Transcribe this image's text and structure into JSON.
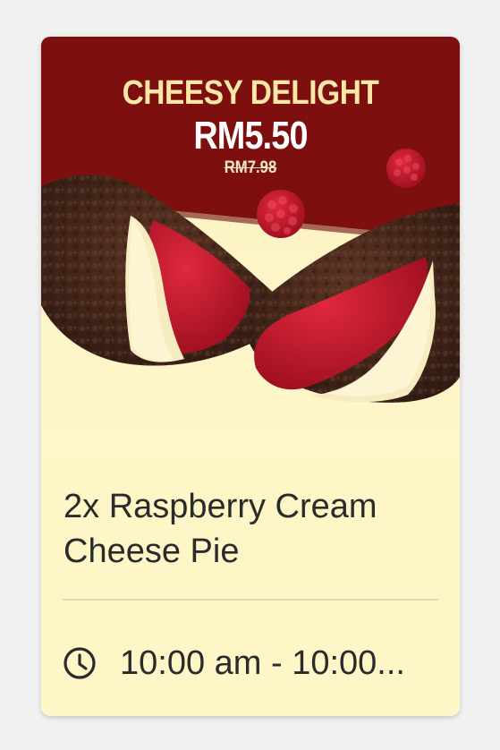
{
  "promo": {
    "headline": "CHEESY DELIGHT",
    "price": "RM5.50",
    "original_price": "RM7.98"
  },
  "product": {
    "title": "2x Raspberry Cream Cheese Pie",
    "hours": "10:00 am - 10:00..."
  },
  "colors": {
    "banner_red": "#7d0f0f",
    "card_cream": "#fff6c7",
    "headline_yellow": "#fbe8a6"
  },
  "icons": {
    "clock": "clock-icon"
  }
}
